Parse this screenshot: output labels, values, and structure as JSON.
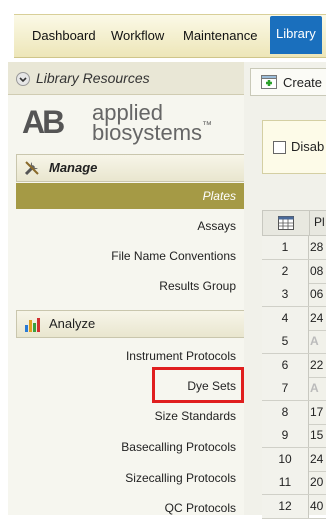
{
  "tabs": [
    {
      "label": "Dashboard"
    },
    {
      "label": "Workflow"
    },
    {
      "label": "Maintenance"
    },
    {
      "label": "Library",
      "active": true
    }
  ],
  "left_panel": {
    "title": "Library Resources",
    "logo": {
      "mark": "A‌B",
      "line1": "applied",
      "line2": "biosystems",
      "tm": "™"
    },
    "manage": {
      "label": "Manage",
      "items": [
        "Plates",
        "Assays",
        "File Name Conventions",
        "Results Group"
      ],
      "selected": "Plates"
    },
    "analyze": {
      "label": "Analyze",
      "items": [
        "Instrument Protocols",
        "Dye Sets",
        "Size Standards",
        "Basecalling Protocols",
        "Sizecalling Protocols",
        "QC Protocols"
      ],
      "highlighted": "Dye Sets"
    }
  },
  "right_panel": {
    "create_label": "Create",
    "filter_label": "Disab",
    "grid": {
      "header": "Pl",
      "rows": [
        {
          "num": "1",
          "value": "28"
        },
        {
          "num": "2",
          "value": "08"
        },
        {
          "num": "3",
          "value": "06"
        },
        {
          "num": "4",
          "value": "24"
        },
        {
          "num": "5",
          "value": "A",
          "faded": true
        },
        {
          "num": "6",
          "value": "22"
        },
        {
          "num": "7",
          "value": "A",
          "faded": true
        },
        {
          "num": "8",
          "value": "17"
        },
        {
          "num": "9",
          "value": "15"
        },
        {
          "num": "10",
          "value": "24"
        },
        {
          "num": "11",
          "value": "20"
        },
        {
          "num": "12",
          "value": "40"
        }
      ]
    }
  },
  "colors": {
    "active_tab": "#1a6fbd",
    "selected_item": "#a59a45",
    "highlight": "#e01e1e"
  }
}
